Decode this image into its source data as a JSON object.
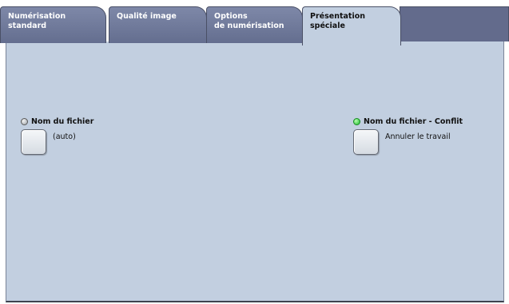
{
  "tabs": [
    {
      "line1": "Numérisation",
      "line2": "standard",
      "active": false
    },
    {
      "line1": "Qualité image",
      "line2": "",
      "active": false
    },
    {
      "line1": "Options",
      "line2": "de numérisation",
      "active": false
    },
    {
      "line1": "Présentation",
      "line2": "spéciale",
      "active": true
    }
  ],
  "filename": {
    "label": "Nom du fichier",
    "value": "(auto)",
    "indicator": "off"
  },
  "filename_conflict": {
    "label": "Nom du fichier - Conflit",
    "value": "Annuler le travail",
    "indicator": "on"
  },
  "colors": {
    "panel_bg": "#c2cfe0",
    "inactive_tab": "#6f7a99",
    "indicator_on": "#17b92a"
  }
}
